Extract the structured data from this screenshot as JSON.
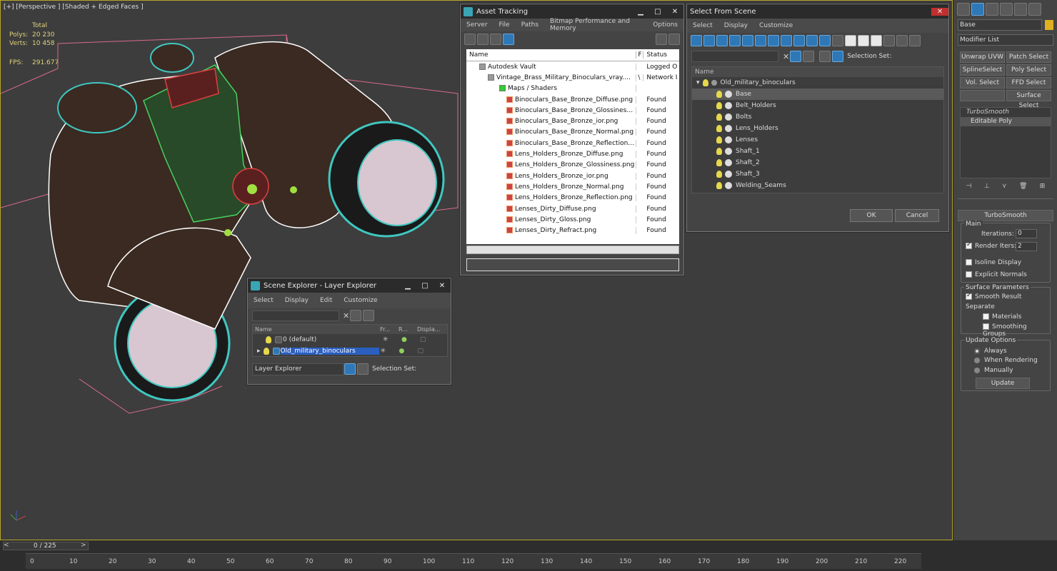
{
  "viewport": {
    "label": "[+] [Perspective ] [Shaded + Edged Faces ]",
    "stats": {
      "total_label": "Total",
      "polys_label": "Polys:",
      "polys_value": "20 230",
      "verts_label": "Verts:",
      "verts_value": "10 458",
      "fps_label": "FPS:",
      "fps_value": "291.677"
    }
  },
  "asset_tracking": {
    "title": "Asset Tracking",
    "menu": [
      "Server",
      "File",
      "Paths",
      "Bitmap Performance and Memory",
      "Options"
    ],
    "col_name": "Name",
    "col_f": "F",
    "col_status": "Status",
    "rows": [
      {
        "name": "Autodesk Vault",
        "f": "",
        "status": "Logged O"
      },
      {
        "name": "Vintage_Brass_Military_Binoculars_vray.max",
        "f": "\\",
        "status": "Network I"
      },
      {
        "name": "Maps / Shaders",
        "f": "",
        "status": ""
      },
      {
        "name": "Binoculars_Base_Bronze_Diffuse.png",
        "f": "",
        "status": "Found"
      },
      {
        "name": "Binoculars_Base_Bronze_Glossiness.p...",
        "f": "",
        "status": "Found"
      },
      {
        "name": "Binoculars_Base_Bronze_ior.png",
        "f": "",
        "status": "Found"
      },
      {
        "name": "Binoculars_Base_Bronze_Normal.png",
        "f": "",
        "status": "Found"
      },
      {
        "name": "Binoculars_Base_Bronze_Reflection.p...",
        "f": "",
        "status": "Found"
      },
      {
        "name": "Lens_Holders_Bronze_Diffuse.png",
        "f": "",
        "status": "Found"
      },
      {
        "name": "Lens_Holders_Bronze_Glossiness.png",
        "f": "",
        "status": "Found"
      },
      {
        "name": "Lens_Holders_Bronze_ior.png",
        "f": "",
        "status": "Found"
      },
      {
        "name": "Lens_Holders_Bronze_Normal.png",
        "f": "",
        "status": "Found"
      },
      {
        "name": "Lens_Holders_Bronze_Reflection.png",
        "f": "",
        "status": "Found"
      },
      {
        "name": "Lenses_Dirty_Diffuse.png",
        "f": "",
        "status": "Found"
      },
      {
        "name": "Lenses_Dirty_Gloss.png",
        "f": "",
        "status": "Found"
      },
      {
        "name": "Lenses_Dirty_Refract.png",
        "f": "",
        "status": "Found"
      }
    ]
  },
  "select_from_scene": {
    "title": "Select From Scene",
    "menu": [
      "Select",
      "Display",
      "Customize"
    ],
    "selection_set_label": "Selection Set:",
    "col_name": "Name",
    "root": "Old_military_binoculars",
    "items": [
      "Base",
      "Belt_Holders",
      "Bolts",
      "Lens_Holders",
      "Lenses",
      "Shaft_1",
      "Shaft_2",
      "Shaft_3",
      "Welding_Seams"
    ],
    "ok_label": "OK",
    "cancel_label": "Cancel"
  },
  "scene_explorer": {
    "title": "Scene Explorer - Layer Explorer",
    "menu": [
      "Select",
      "Display",
      "Edit",
      "Customize"
    ],
    "col_name": "Name",
    "col_fr": "Fr...",
    "col_r": "R...",
    "col_disp": "Displa...",
    "layers": [
      "0 (default)",
      "Old_military_binoculars"
    ],
    "explorer_dropdown": "Layer Explorer",
    "selection_set_label": "Selection Set:"
  },
  "command_panel": {
    "object_name": "Base",
    "modifier_list": "Modifier List",
    "buttons": [
      "Unwrap UVW",
      "Patch Select",
      "SplineSelect",
      "Poly Select",
      "Vol. Select",
      "FFD Select",
      "",
      "Surface Select"
    ],
    "stack": [
      "TurboSmooth",
      "Editable Poly"
    ],
    "rollout_title": "TurboSmooth",
    "main_label": "Main",
    "iterations_label": "Iterations:",
    "iterations_value": "0",
    "render_iters_label": "Render Iters:",
    "render_iters_value": "2",
    "isoline_label": "Isoline Display",
    "explicit_normals_label": "Explicit Normals",
    "surface_params_label": "Surface Parameters",
    "smooth_result_label": "Smooth Result",
    "separate_label": "Separate",
    "materials_label": "Materials",
    "smoothing_groups_label": "Smoothing Groups",
    "update_options_label": "Update Options",
    "always_label": "Always",
    "when_rendering_label": "When Rendering",
    "manually_label": "Manually",
    "update_button": "Update"
  },
  "timeline": {
    "frame_display": "0 / 225",
    "ticks": [
      "0",
      "10",
      "20",
      "30",
      "40",
      "50",
      "60",
      "70",
      "80",
      "90",
      "100",
      "110",
      "120",
      "130",
      "140",
      "150",
      "160",
      "170",
      "180",
      "190",
      "200",
      "210",
      "220"
    ]
  },
  "colors": {
    "accent": "#2f78b8",
    "viewport_border": "#b5a62a",
    "stat_text": "#e0d27a"
  }
}
